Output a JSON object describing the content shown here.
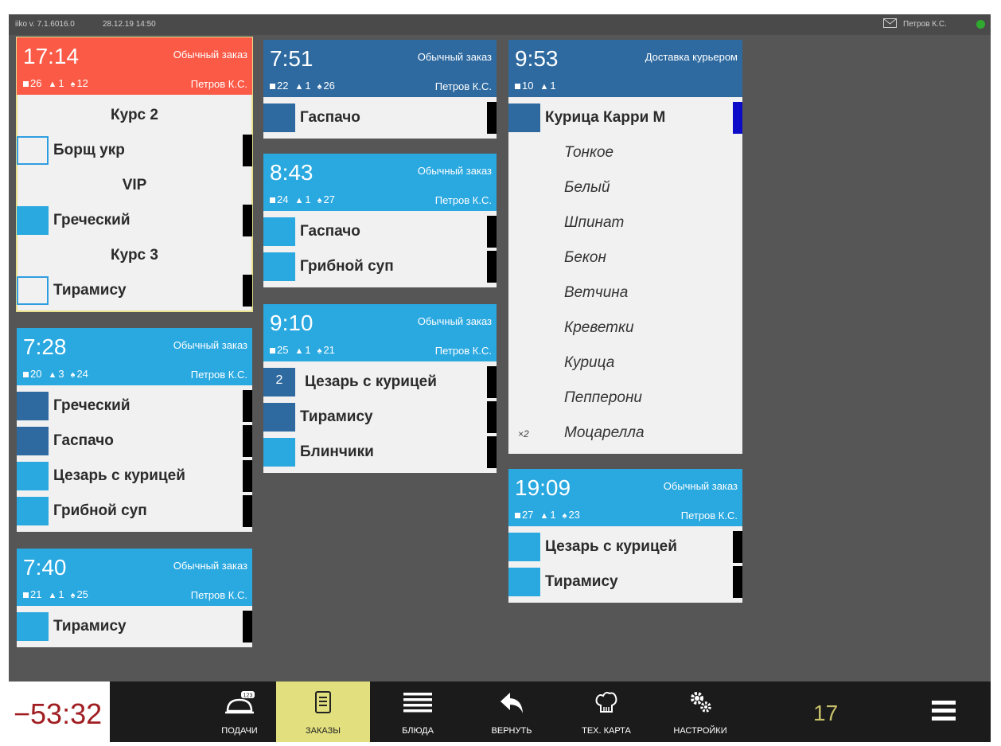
{
  "topbar": {
    "version": "iiko v. 7.1.6016.0",
    "datetime": "28.12.19 14:50",
    "user": "Петров К.С."
  },
  "colors": {
    "urgent": "#fb5a47",
    "dark": "#2e6aa0",
    "light": "#2aa8e0",
    "outline": "#2f9ee0"
  },
  "orders": [
    {
      "time": "17:14",
      "type": "Обычный заказ",
      "table": "26",
      "guests": "1",
      "number": "12",
      "waiter": "Петров К.С.",
      "color": "urgent",
      "items": [
        {
          "kind": "course",
          "name": "Курс 2"
        },
        {
          "kind": "dish",
          "name": "Борщ укр",
          "status": "outline",
          "bar": true
        },
        {
          "kind": "course",
          "name": "VIP"
        },
        {
          "kind": "dish",
          "name": "Греческий",
          "status": "light",
          "bar": true
        },
        {
          "kind": "course",
          "name": "Курс 3"
        },
        {
          "kind": "dish",
          "name": "Тирамису",
          "status": "outline",
          "bar": true
        }
      ]
    },
    {
      "time": "7:28",
      "type": "Обычный заказ",
      "table": "20",
      "guests": "3",
      "number": "24",
      "waiter": "Петров К.С.",
      "color": "light",
      "items": [
        {
          "kind": "dish",
          "name": "Греческий",
          "status": "dark",
          "bar": true
        },
        {
          "kind": "dish",
          "name": "Гаспачо",
          "status": "dark",
          "bar": true
        },
        {
          "kind": "dish",
          "name": "Цезарь с курицей",
          "status": "light",
          "bar": true
        },
        {
          "kind": "dish",
          "name": "Грибной суп",
          "status": "light",
          "bar": true
        }
      ]
    },
    {
      "time": "7:40",
      "type": "Обычный заказ",
      "table": "21",
      "guests": "1",
      "number": "25",
      "waiter": "Петров К.С.",
      "color": "light",
      "items": [
        {
          "kind": "dish",
          "name": "Тирамису",
          "status": "light",
          "bar": true
        }
      ]
    },
    {
      "time": "7:51",
      "type": "Обычный заказ",
      "table": "22",
      "guests": "1",
      "number": "26",
      "waiter": "Петров К.С.",
      "color": "dark",
      "items": [
        {
          "kind": "dish",
          "name": "Гаспачо",
          "status": "dark",
          "bar": true
        }
      ]
    },
    {
      "time": "8:43",
      "type": "Обычный заказ",
      "table": "24",
      "guests": "1",
      "number": "27",
      "waiter": "Петров К.С.",
      "color": "light",
      "items": [
        {
          "kind": "dish",
          "name": "Гаспачо",
          "status": "light",
          "bar": true
        },
        {
          "kind": "dish",
          "name": "Грибной суп",
          "status": "light",
          "bar": true
        }
      ]
    },
    {
      "time": "9:10",
      "type": "Обычный заказ",
      "table": "25",
      "guests": "1",
      "number": "21",
      "waiter": "Петров К.С.",
      "color": "light",
      "items": [
        {
          "kind": "dish",
          "name": "Цезарь с курицей",
          "status": "dark",
          "qty": "2",
          "bar": true
        },
        {
          "kind": "dish",
          "name": "Тирамису",
          "status": "dark",
          "bar": true
        },
        {
          "kind": "dish",
          "name": "Блинчики",
          "status": "light",
          "bar": true
        }
      ]
    },
    {
      "time": "9:53",
      "type": "Доставка курьером",
      "table": "10",
      "guests": "1",
      "number": "",
      "waiter": "",
      "color": "dark",
      "items": [
        {
          "kind": "dish",
          "name": "Курица Карри М",
          "status": "dark",
          "bar": true,
          "barColor": "#0c0cc8"
        },
        {
          "kind": "mod",
          "name": "Тонкое"
        },
        {
          "kind": "mod",
          "name": "Белый"
        },
        {
          "kind": "mod",
          "name": "Шпинат"
        },
        {
          "kind": "mod",
          "name": "Бекон"
        },
        {
          "kind": "mod",
          "name": "Ветчина"
        },
        {
          "kind": "mod",
          "name": "Креветки"
        },
        {
          "kind": "mod",
          "name": "Курица"
        },
        {
          "kind": "mod",
          "name": "Пепперони"
        },
        {
          "kind": "mod",
          "name": "Моцарелла",
          "mult": "×2"
        }
      ]
    },
    {
      "time": "19:09",
      "type": "Обычный заказ",
      "table": "27",
      "guests": "1",
      "number": "23",
      "waiter": "Петров К.С.",
      "color": "light",
      "items": [
        {
          "kind": "dish",
          "name": "Цезарь с курицей",
          "status": "light",
          "bar": true
        },
        {
          "kind": "dish",
          "name": "Тирамису",
          "status": "light",
          "bar": true
        }
      ]
    }
  ],
  "bottombar": {
    "timer": "−53:32",
    "counter": "17",
    "buttons": [
      {
        "label": "ПОДАЧИ",
        "icon": "cloche-icon",
        "badge": "123"
      },
      {
        "label": "ЗАКАЗЫ",
        "icon": "receipt-icon",
        "active": true
      },
      {
        "label": "БЛЮДА",
        "icon": "lines-icon"
      },
      {
        "label": "ВЕРНУТЬ",
        "icon": "return-arrow-icon"
      },
      {
        "label": "ТЕХ. КАРТА",
        "icon": "chef-hat-icon"
      },
      {
        "label": "НАСТРОЙКИ",
        "icon": "gears-icon"
      }
    ]
  }
}
